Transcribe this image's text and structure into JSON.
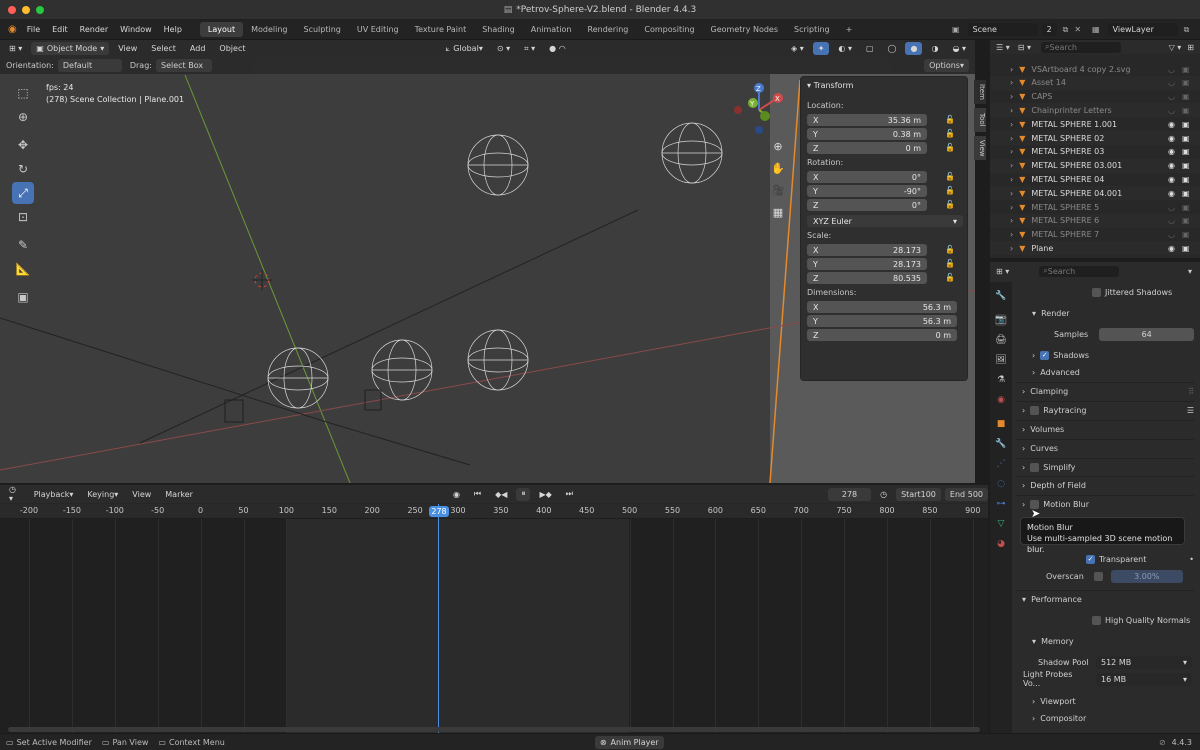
{
  "window": {
    "title": "Petrov-Sphere-V2.blend - Blender 4.4.3"
  },
  "menu": [
    "File",
    "Edit",
    "Render",
    "Window",
    "Help"
  ],
  "workspaces": [
    "Layout",
    "Modeling",
    "Sculpting",
    "UV Editing",
    "Texture Paint",
    "Shading",
    "Animation",
    "Rendering",
    "Compositing",
    "Geometry Nodes",
    "Scripting"
  ],
  "active_workspace": "Layout",
  "scene": {
    "label": "Scene",
    "count": "2",
    "view_layer": "ViewLayer"
  },
  "viewport": {
    "mode": "Object Mode",
    "menus": [
      "View",
      "Select",
      "Add",
      "Object"
    ],
    "transform_orientation": "Global",
    "orientation_label": "Orientation:",
    "orientation_value": "Default",
    "drag_label": "Drag:",
    "drag_value": "Select Box",
    "options": "Options",
    "fps": "fps: 24",
    "collection_info": "(278) Scene Collection | Plane.001"
  },
  "transform": {
    "title": "Transform",
    "location_label": "Location:",
    "location": [
      {
        "axis": "X",
        "value": "35.36 m"
      },
      {
        "axis": "Y",
        "value": "0.38 m"
      },
      {
        "axis": "Z",
        "value": "0 m"
      }
    ],
    "rotation_label": "Rotation:",
    "rotation": [
      {
        "axis": "X",
        "value": "0°"
      },
      {
        "axis": "Y",
        "value": "-90°"
      },
      {
        "axis": "Z",
        "value": "0°"
      }
    ],
    "rotation_mode": "XYZ Euler",
    "scale_label": "Scale:",
    "scale": [
      {
        "axis": "X",
        "value": "28.173"
      },
      {
        "axis": "Y",
        "value": "28.173"
      },
      {
        "axis": "Z",
        "value": "80.535"
      }
    ],
    "dimensions_label": "Dimensions:",
    "dimensions": [
      {
        "axis": "X",
        "value": "56.3 m"
      },
      {
        "axis": "Y",
        "value": "56.3 m"
      },
      {
        "axis": "Z",
        "value": "0 m"
      }
    ]
  },
  "sidebar_tabs": [
    "Item",
    "Tool",
    "View"
  ],
  "timeline": {
    "menus": [
      "Playback",
      "Keying",
      "View",
      "Marker"
    ],
    "current_frame": "278",
    "start_label": "Start",
    "start": "100",
    "end_label": "End",
    "end": "500",
    "ruler": [
      "-200",
      "-150",
      "-100",
      "-50",
      "0",
      "50",
      "100",
      "150",
      "200",
      "250",
      "300",
      "350",
      "400",
      "450",
      "500",
      "550",
      "600",
      "650",
      "700",
      "750",
      "800",
      "850",
      "900"
    ]
  },
  "outliner": {
    "search_placeholder": "Search",
    "items": [
      {
        "name": "VSArtboard 4 copy 2.svg",
        "dim": true
      },
      {
        "name": "Asset 14",
        "dim": true
      },
      {
        "name": "CAPS",
        "dim": true
      },
      {
        "name": "Chainprinter Letters",
        "dim": true
      },
      {
        "name": "METAL SPHERE 1.001",
        "dim": false
      },
      {
        "name": "METAL SPHERE 02",
        "dim": false
      },
      {
        "name": "METAL SPHERE 03",
        "dim": false
      },
      {
        "name": "METAL SPHERE 03.001",
        "dim": false
      },
      {
        "name": "METAL SPHERE 04",
        "dim": false
      },
      {
        "name": "METAL SPHERE 04.001",
        "dim": false
      },
      {
        "name": "METAL SPHERE 5",
        "dim": true
      },
      {
        "name": "METAL SPHERE 6",
        "dim": true
      },
      {
        "name": "METAL SPHERE 7",
        "dim": true
      },
      {
        "name": "Plane",
        "dim": false
      }
    ]
  },
  "properties": {
    "search_placeholder": "Search",
    "jittered_shadows": "Jittered Shadows",
    "render": "Render",
    "samples_label": "Samples",
    "samples": "64",
    "shadows": "Shadows",
    "advanced": "Advanced",
    "clamping": "Clamping",
    "raytracing": "Raytracing",
    "volumes": "Volumes",
    "curves": "Curves",
    "simplify": "Simplify",
    "depth_of_field": "Depth of Field",
    "motion_blur": "Motion Blur",
    "transparent": "Transparent",
    "overscan_label": "Overscan",
    "overscan": "3.00%",
    "performance": "Performance",
    "hq_normals": "High Quality Normals",
    "memory": "Memory",
    "shadow_pool_label": "Shadow Pool",
    "shadow_pool": "512 MB",
    "light_probes_label": "Light Probes Vo...",
    "light_probes": "16 MB",
    "viewport": "Viewport",
    "compositor": "Compositor"
  },
  "tooltip": {
    "title": "Motion Blur",
    "body": "Use multi-sampled 3D scene motion blur."
  },
  "status": {
    "item1": "Set Active Modifier",
    "item2": "Pan View",
    "item3": "Context Menu",
    "center": "Anim Player",
    "version": "4.4.3"
  },
  "colors": {
    "accent": "#4772b3",
    "orange": "#e58a2c",
    "playhead": "#4a90e2"
  }
}
